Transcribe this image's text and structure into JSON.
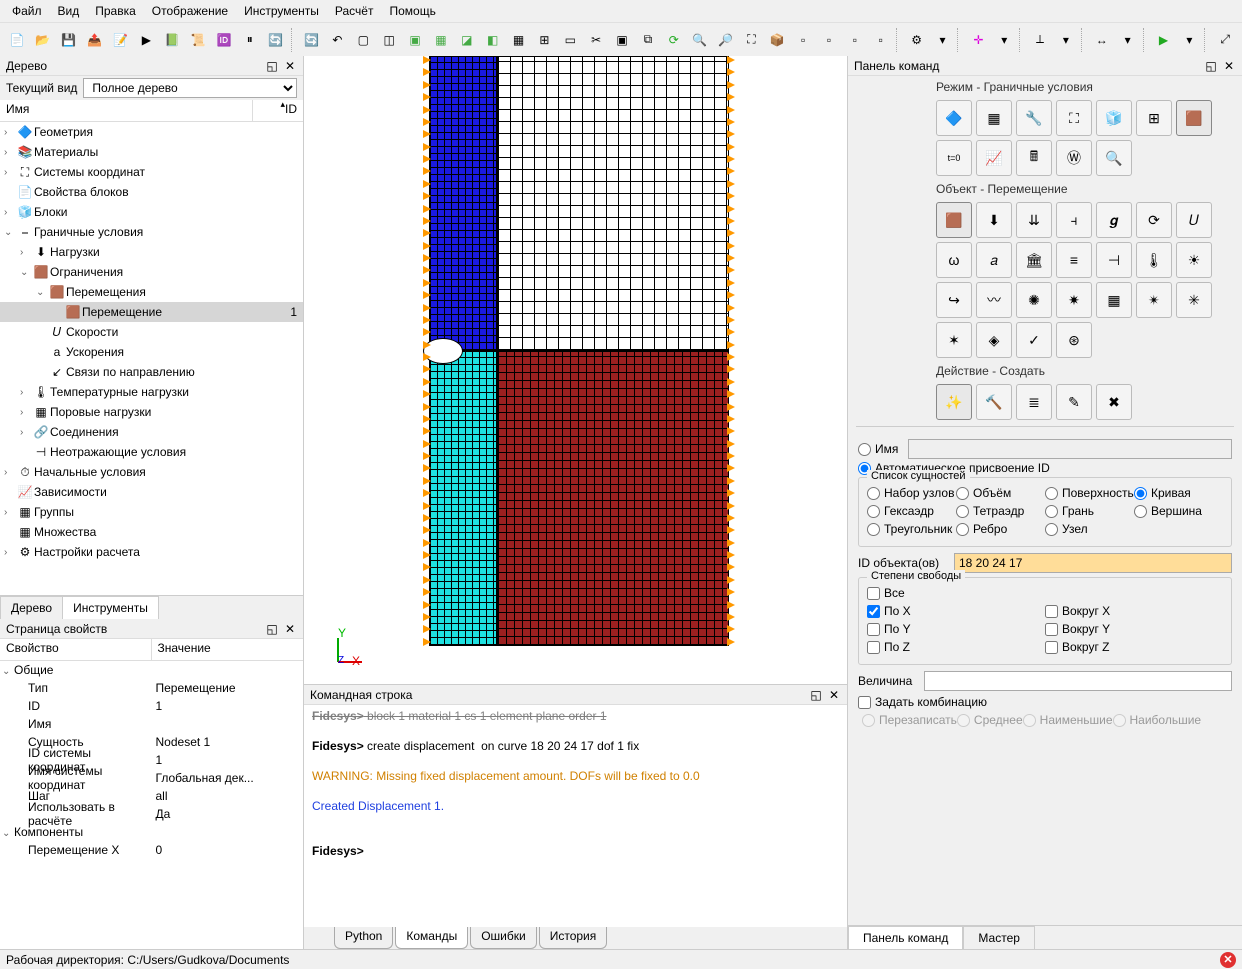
{
  "menu": [
    "Файл",
    "Вид",
    "Правка",
    "Отображение",
    "Инструменты",
    "Расчёт",
    "Помощь"
  ],
  "left": {
    "tree_panel_title": "Дерево",
    "view_label": "Текущий вид",
    "view_value": "Полное дерево",
    "col_name": "Имя",
    "col_id": "ID",
    "tabs": [
      "Дерево",
      "Инструменты"
    ],
    "tree": [
      {
        "indent": 0,
        "arrow": ">",
        "icon": "🔷",
        "label": "Геометрия"
      },
      {
        "indent": 0,
        "arrow": ">",
        "icon": "📚",
        "label": "Материалы"
      },
      {
        "indent": 0,
        "arrow": ">",
        "icon": "⛶",
        "label": "Системы координат"
      },
      {
        "indent": 0,
        "arrow": "",
        "icon": "📄",
        "label": "Свойства блоков"
      },
      {
        "indent": 0,
        "arrow": ">",
        "icon": "🧊",
        "label": "Блоки"
      },
      {
        "indent": 0,
        "arrow": "v",
        "icon": "⎯",
        "label": "Граничные условия"
      },
      {
        "indent": 1,
        "arrow": ">",
        "icon": "⬇",
        "label": "Нагрузки"
      },
      {
        "indent": 1,
        "arrow": "v",
        "icon": "🟫",
        "label": "Ограничения"
      },
      {
        "indent": 2,
        "arrow": "v",
        "icon": "🟫",
        "label": "Перемещения"
      },
      {
        "indent": 3,
        "arrow": "",
        "icon": "🟫",
        "label": "Перемещение",
        "id": "1",
        "selected": true
      },
      {
        "indent": 2,
        "arrow": "",
        "icon": "𝑈",
        "label": "Скорости"
      },
      {
        "indent": 2,
        "arrow": "",
        "icon": "a",
        "label": "Ускорения"
      },
      {
        "indent": 2,
        "arrow": "",
        "icon": "↙",
        "label": "Связи по направлению"
      },
      {
        "indent": 1,
        "arrow": ">",
        "icon": "🌡",
        "label": "Температурные нагрузки"
      },
      {
        "indent": 1,
        "arrow": ">",
        "icon": "▦",
        "label": "Поровые нагрузки"
      },
      {
        "indent": 1,
        "arrow": ">",
        "icon": "🔗",
        "label": "Соединения"
      },
      {
        "indent": 1,
        "arrow": "",
        "icon": "⊣",
        "label": "Неотражающие условия"
      },
      {
        "indent": 0,
        "arrow": ">",
        "icon": "⏱",
        "label": "Начальные условия"
      },
      {
        "indent": 0,
        "arrow": "",
        "icon": "📈",
        "label": "Зависимости"
      },
      {
        "indent": 0,
        "arrow": ">",
        "icon": "▦",
        "label": "Группы"
      },
      {
        "indent": 0,
        "arrow": "",
        "icon": "▦",
        "label": "Множества"
      },
      {
        "indent": 0,
        "arrow": ">",
        "icon": "⚙",
        "label": "Настройки расчета"
      }
    ]
  },
  "props": {
    "title": "Страница свойств",
    "col1": "Свойство",
    "col2": "Значение",
    "rows": [
      {
        "group": true,
        "label": "Общие"
      },
      {
        "label": "Тип",
        "value": "Перемещение"
      },
      {
        "label": "ID",
        "value": "1"
      },
      {
        "label": "Имя",
        "value": ""
      },
      {
        "label": "Сущность",
        "value": "Nodeset 1"
      },
      {
        "label": "ID системы координат",
        "value": "1"
      },
      {
        "label": "Имя системы координат",
        "value": "Глобальная дек..."
      },
      {
        "label": "Шаг",
        "value": "all"
      },
      {
        "label": "Использовать в расчёте",
        "value": "Да"
      },
      {
        "group": true,
        "label": "Компоненты"
      },
      {
        "label": "Перемещение X",
        "value": "0"
      }
    ]
  },
  "cmd": {
    "title": "Командная строка",
    "line0_prompt": "Fidesys>",
    "line0_rest": " block 1 material 1 cs 1 element plane order 1",
    "line1_prompt": "Fidesys>",
    "line1_rest": " create displacement  on curve 18 20 24 17 dof 1 fix",
    "warn": "WARNING: Missing fixed displacement amount. DOFs will be fixed to 0.0",
    "ok": "Created Displacement 1.",
    "prompt2": "Fidesys>",
    "tabs": [
      "Python",
      "Команды",
      "Ошибки",
      "История"
    ]
  },
  "right": {
    "title": "Панель команд",
    "mode_label": "Режим - Граничные условия",
    "object_label": "Объект - Перемещение",
    "action_label": "Действие - Создать",
    "name_radio": "Имя",
    "autoid_radio": "Автоматическое присвоение ID",
    "entities_legend": "Список сущностей",
    "entities": [
      "Набор узлов",
      "Объём",
      "Поверхность",
      "Кривая",
      "Гексаэдр",
      "Тетраэдр",
      "Грань",
      "Вершина",
      "Треугольник",
      "Ребро",
      "Узел"
    ],
    "entity_selected": 3,
    "id_label": "ID объекта(ов)",
    "id_value": "18 20 24 17",
    "dof_legend": "Степени свободы",
    "dof": [
      "Все",
      "По X",
      "По Y",
      "По Z",
      "Вокруг X",
      "Вокруг Y",
      "Вокруг Z"
    ],
    "dof_checked": [
      1
    ],
    "value_label": "Величина",
    "value_value": "",
    "combo_label": "Задать комбинацию",
    "combo_opts": [
      "Перезаписать",
      "Среднее",
      "Наименьшие",
      "Наибольшие"
    ],
    "tabs": [
      "Панель команд",
      "Мастер"
    ]
  },
  "status": {
    "workdir_label": "Рабочая директория:",
    "workdir": "C:/Users/Gudkova/Documents"
  }
}
